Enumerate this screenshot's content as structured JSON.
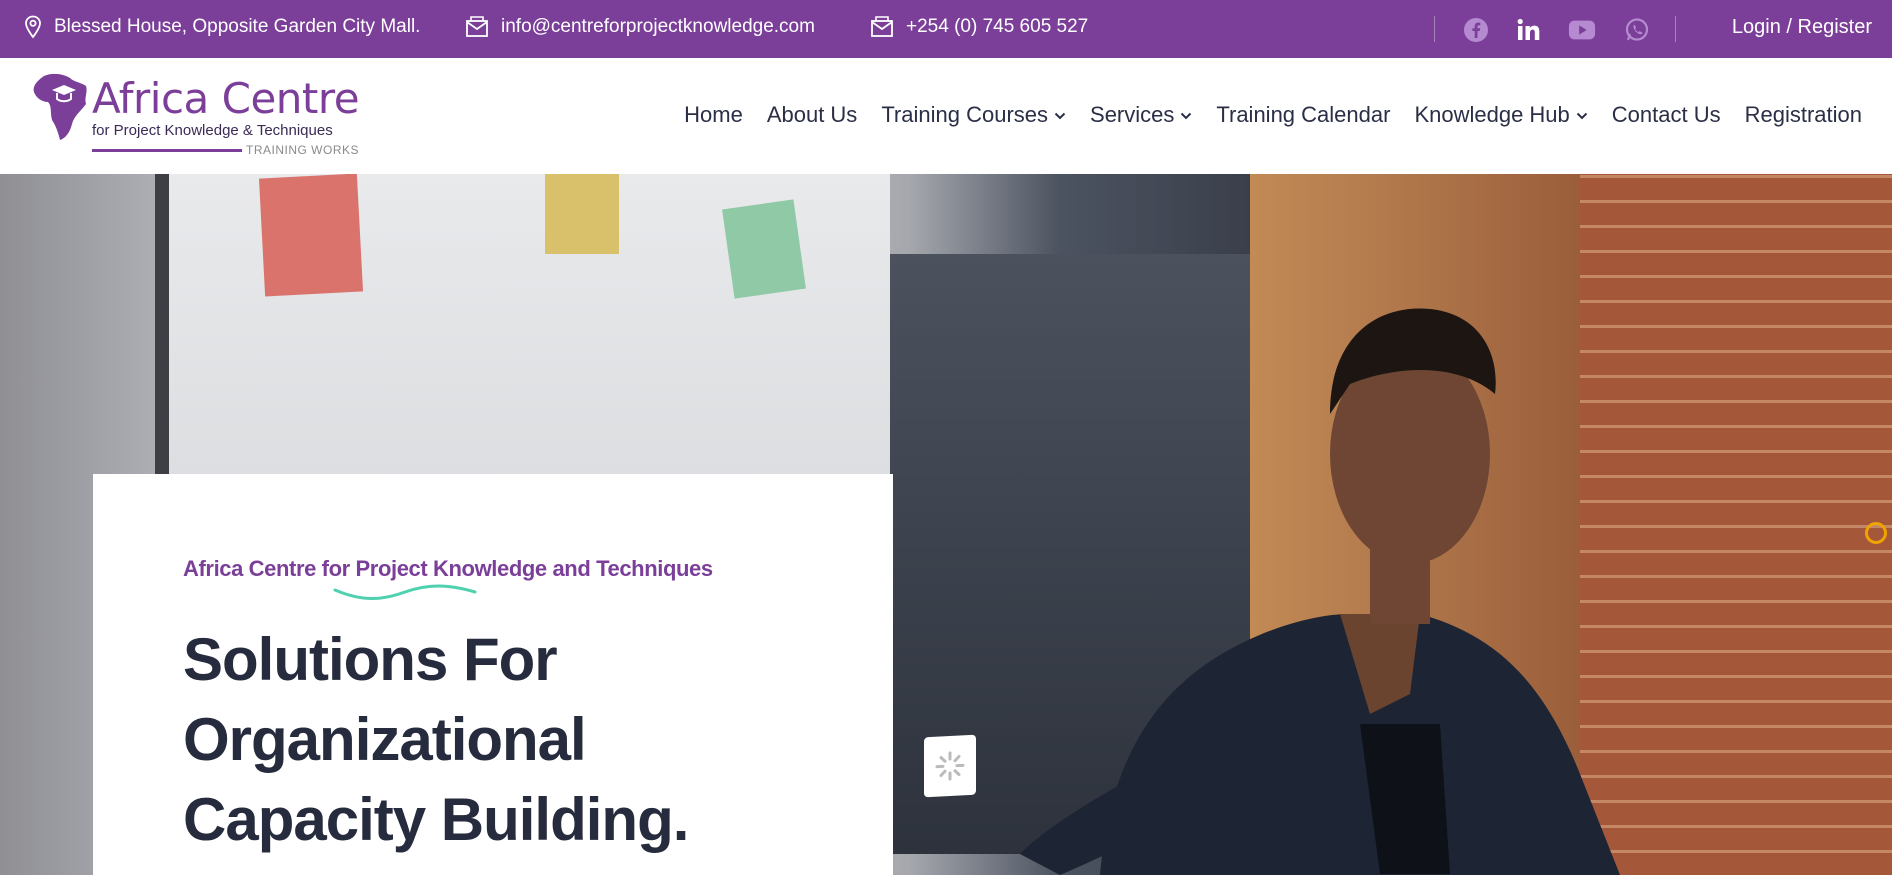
{
  "topbar": {
    "address": "Blessed House, Opposite Garden City Mall.",
    "email": "info@centreforprojectknowledge.com",
    "phone": "+254 (0) 745 605 527",
    "social": [
      "facebook-icon",
      "linkedin-icon",
      "youtube-icon",
      "whatsapp-icon"
    ],
    "login_label": "Login / Register"
  },
  "header": {
    "logo": {
      "title": "Africa Centre",
      "subtitle": "for Project Knowledge & Techniques",
      "tagline": "TRAINING WORKS"
    },
    "nav": [
      {
        "label": "Home",
        "dropdown": false
      },
      {
        "label": "About Us",
        "dropdown": false
      },
      {
        "label": "Training Courses",
        "dropdown": true
      },
      {
        "label": "Services",
        "dropdown": true
      },
      {
        "label": "Training Calendar",
        "dropdown": false
      },
      {
        "label": "Knowledge Hub",
        "dropdown": true
      },
      {
        "label": "Contact Us",
        "dropdown": false
      },
      {
        "label": "Registration",
        "dropdown": false
      }
    ]
  },
  "hero": {
    "kicker": "Africa Centre for Project Knowledge and Techniques",
    "title_lines": [
      "Solutions For",
      "Organizational",
      "Capacity Building."
    ]
  },
  "colors": {
    "brand": "#7b3f99",
    "heading": "#262b3d",
    "accent": "#4fd1b0",
    "ring": "#f0a400"
  }
}
